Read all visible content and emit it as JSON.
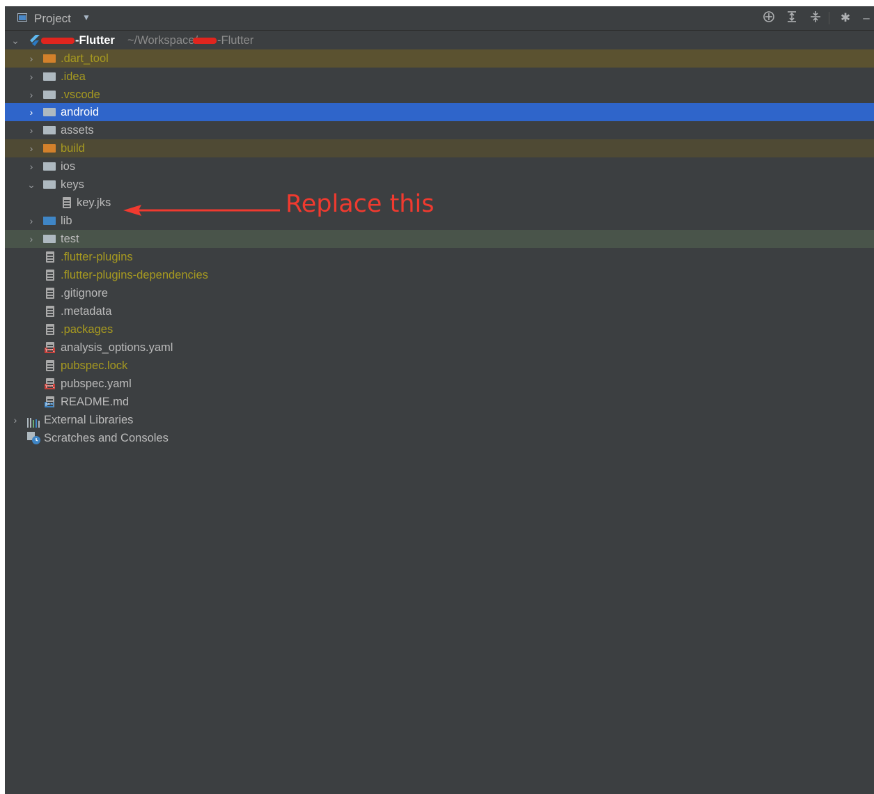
{
  "header": {
    "title": "Project",
    "icons": [
      "crosshair-icon",
      "expand-all-icon",
      "collapse-all-icon",
      "gear-icon",
      "minimize-icon"
    ]
  },
  "root": {
    "name_suffix": "-Flutter",
    "path_prefix": "~/Workspace/",
    "path_suffix": "-Flutter"
  },
  "tree": {
    "dart_tool": ".dart_tool",
    "idea": ".idea",
    "vscode": ".vscode",
    "android": "android",
    "assets": "assets",
    "build": "build",
    "ios": "ios",
    "keys": "keys",
    "key_jks": "key.jks",
    "lib": "lib",
    "test": "test",
    "flutter_plugins": ".flutter-plugins",
    "flutter_plugins_dependencies": ".flutter-plugins-dependencies",
    "gitignore": ".gitignore",
    "metadata": ".metadata",
    "packages": ".packages",
    "analysis_options": "analysis_options.yaml",
    "pubspec_lock": "pubspec.lock",
    "pubspec_yaml": "pubspec.yaml",
    "readme": "README.md",
    "external_libraries": "External Libraries",
    "scratches": "Scratches and Consoles"
  },
  "tags": {
    "yml": "YML",
    "md": "MD"
  },
  "annotation": {
    "text": "Replace this"
  },
  "colors": {
    "background": "#3c3f41",
    "selection": "#2f65ca",
    "excluded": "#a79a20",
    "annotation": "#f03a2f"
  }
}
